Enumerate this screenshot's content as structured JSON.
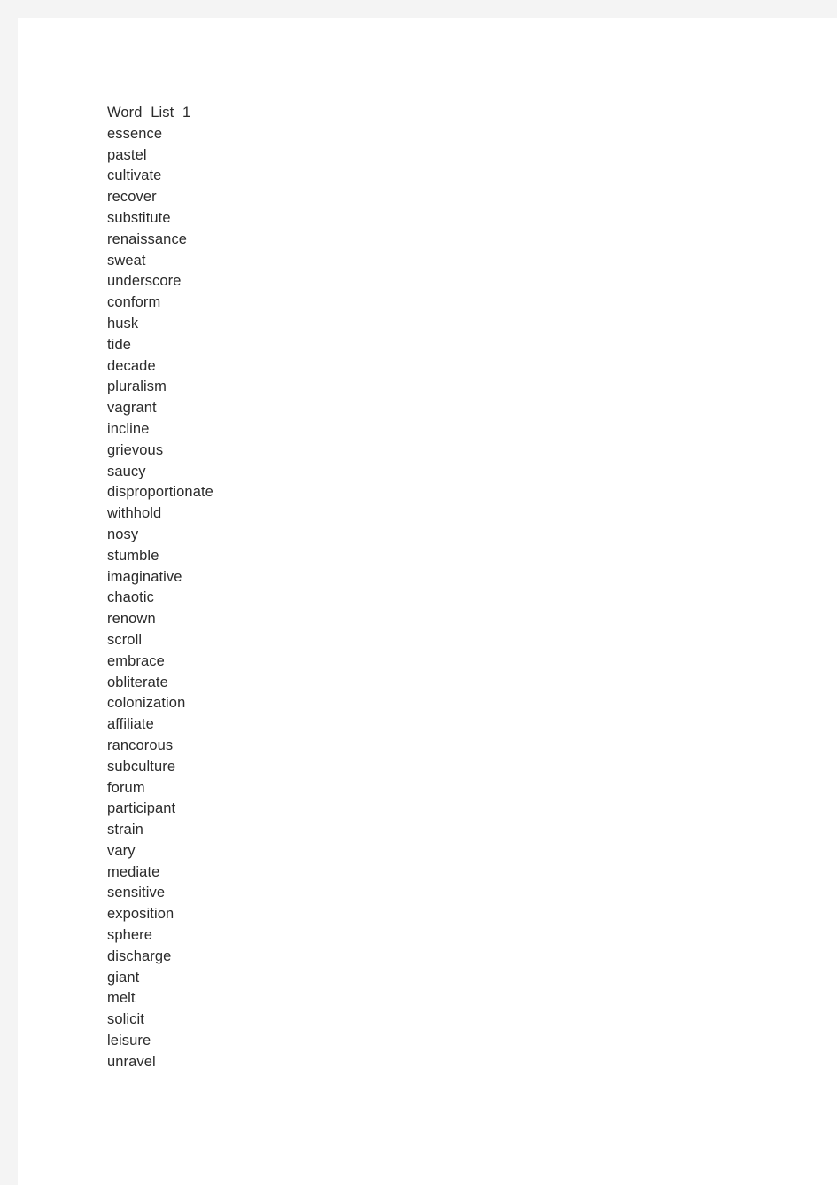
{
  "document": {
    "title": "Word List 1",
    "background_color": "#f4f4f4",
    "page_color": "#ffffff",
    "text_color": "#2b2b2b",
    "lines": [
      "Word List 1",
      "essence",
      "pastel",
      "cultivate",
      "recover",
      "substitute",
      "renaissance",
      "sweat",
      "underscore",
      "conform",
      "husk",
      "tide",
      "decade",
      "pluralism",
      "vagrant",
      "incline",
      "grievous",
      "saucy",
      "disproportionate",
      "withhold",
      "nosy",
      "stumble",
      "imaginative",
      "chaotic",
      "renown",
      "scroll",
      "embrace",
      "obliterate",
      "colonization",
      "affiliate",
      "rancorous",
      "subculture",
      "forum",
      "participant",
      "strain",
      "vary",
      "mediate",
      "sensitive",
      "exposition",
      "sphere",
      "discharge",
      "giant",
      "melt",
      "solicit",
      "leisure",
      "unravel"
    ]
  }
}
